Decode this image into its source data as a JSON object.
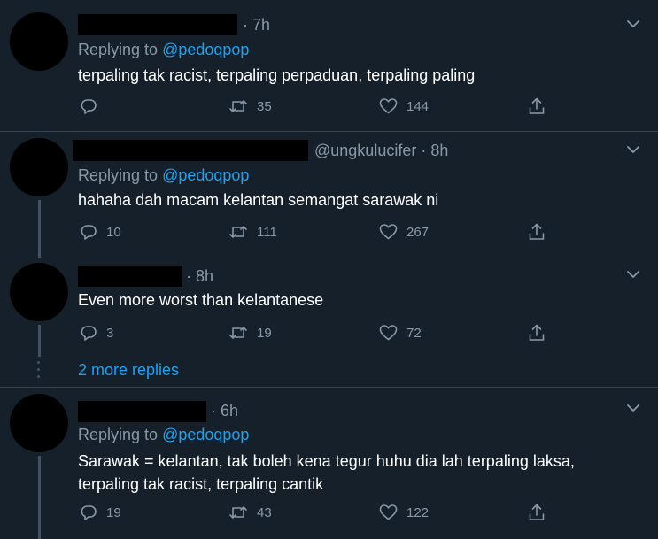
{
  "tweets": [
    {
      "handle": "",
      "time": "· 7h",
      "replying_prefix": "Replying to ",
      "replying_handle": "@pedoqpop",
      "text_lines": [
        "terpaling tak racist, terpaling perpaduan, terpaling paling"
      ],
      "replies": "",
      "retweets": "35",
      "likes": "144"
    },
    {
      "handle": "@ungkulucifer",
      "time": "· 8h",
      "replying_prefix": "Replying to ",
      "replying_handle": "@pedoqpop",
      "text_lines": [
        "hahaha dah macam kelantan semangat sarawak ni"
      ],
      "replies": "10",
      "retweets": "111",
      "likes": "267"
    },
    {
      "handle": "",
      "time": "· 8h",
      "replying_prefix": "",
      "replying_handle": "",
      "text_lines": [
        "Even more worst than kelantanese"
      ],
      "replies": "3",
      "retweets": "19",
      "likes": "72"
    },
    {
      "handle": "",
      "time": "· 6h",
      "replying_prefix": "Replying to ",
      "replying_handle": "@pedoqpop",
      "text_lines": [
        "Sarawak = kelantan, tak boleh kena tegur huhu dia lah terpaling laksa,",
        "terpaling tak racist, terpaling cantik"
      ],
      "replies": "19",
      "retweets": "43",
      "likes": "122"
    }
  ],
  "more_replies": "2 more replies",
  "icons": {
    "reply": "reply-icon",
    "retweet": "retweet-icon",
    "like": "heart-icon",
    "share": "share-icon",
    "menu": "chevron-down-icon"
  },
  "colors": {
    "background": "#15202b",
    "secondary_text": "#8899a6",
    "accent": "#1da1f2",
    "text": "#ffffff"
  }
}
